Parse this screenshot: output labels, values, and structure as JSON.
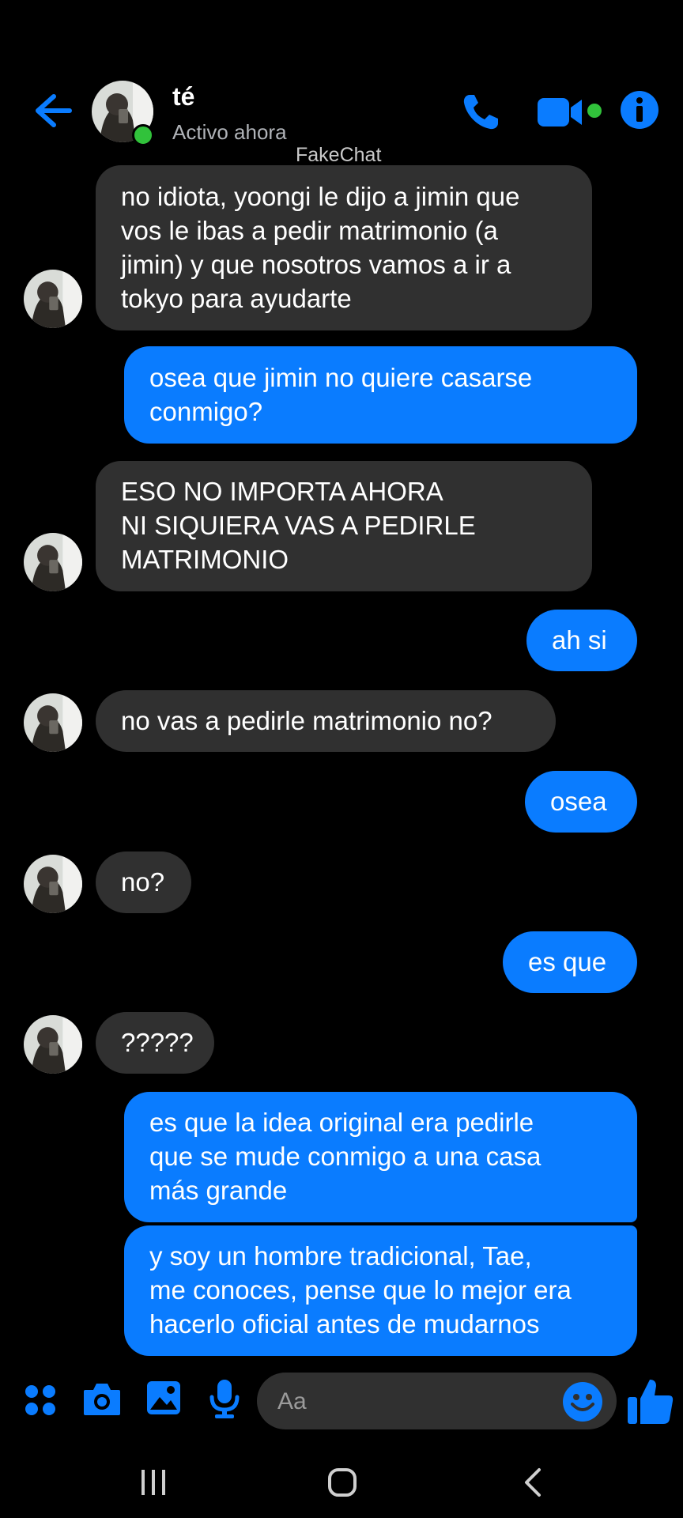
{
  "header": {
    "name": "té",
    "status": "Activo ahora",
    "watermark": "FakeChat"
  },
  "theme": {
    "accent": "#0a7cff",
    "incoming_bg": "#303030",
    "online": "#31c23b"
  },
  "icons": [
    "back-arrow-icon",
    "phone-icon",
    "video-call-icon",
    "info-icon",
    "apps-icon",
    "camera-icon",
    "gallery-icon",
    "microphone-icon",
    "emoji-icon",
    "thumbs-up-icon",
    "recents-nav-icon",
    "home-nav-icon",
    "back-nav-icon"
  ],
  "messages": [
    {
      "dir": "in",
      "text": "no idiota, yoongi le dijo a jimin que\nvos le ibas a pedir matrimonio (a\njimin) y que nosotros vamos a ir a\ntokyo para ayudarte"
    },
    {
      "dir": "out",
      "text": "osea que jimin no quiere casarse\nconmigo?"
    },
    {
      "dir": "in",
      "text": "ESO NO IMPORTA AHORA\nNI SIQUIERA VAS A PEDIRLE\nMATRIMONIO"
    },
    {
      "dir": "out",
      "text": "ah si"
    },
    {
      "dir": "in",
      "text": "no vas a pedirle matrimonio no?"
    },
    {
      "dir": "out",
      "text": "osea"
    },
    {
      "dir": "in",
      "text": "no?"
    },
    {
      "dir": "out",
      "text": "es que"
    },
    {
      "dir": "in",
      "text": "?????"
    },
    {
      "dir": "out",
      "text": "es que la idea original era pedirle\nque se mude conmigo a una casa\nmás grande"
    },
    {
      "dir": "out",
      "text": "y soy un hombre tradicional, Tae,\nme conoces, pense que lo mejor era\nhacerlo oficial antes de mudarnos"
    }
  ],
  "composer": {
    "placeholder": "Aa"
  }
}
